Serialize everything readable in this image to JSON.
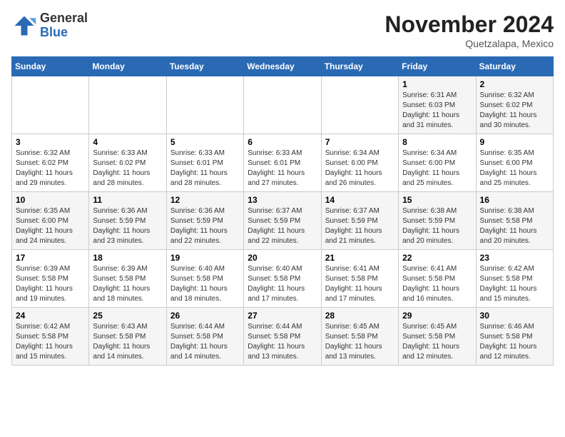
{
  "header": {
    "logo_general": "General",
    "logo_blue": "Blue",
    "month_title": "November 2024",
    "subtitle": "Quetzalapa, Mexico"
  },
  "weekdays": [
    "Sunday",
    "Monday",
    "Tuesday",
    "Wednesday",
    "Thursday",
    "Friday",
    "Saturday"
  ],
  "weeks": [
    [
      {
        "day": "",
        "info": ""
      },
      {
        "day": "",
        "info": ""
      },
      {
        "day": "",
        "info": ""
      },
      {
        "day": "",
        "info": ""
      },
      {
        "day": "",
        "info": ""
      },
      {
        "day": "1",
        "info": "Sunrise: 6:31 AM\nSunset: 6:03 PM\nDaylight: 11 hours and 31 minutes."
      },
      {
        "day": "2",
        "info": "Sunrise: 6:32 AM\nSunset: 6:02 PM\nDaylight: 11 hours and 30 minutes."
      }
    ],
    [
      {
        "day": "3",
        "info": "Sunrise: 6:32 AM\nSunset: 6:02 PM\nDaylight: 11 hours and 29 minutes."
      },
      {
        "day": "4",
        "info": "Sunrise: 6:33 AM\nSunset: 6:02 PM\nDaylight: 11 hours and 28 minutes."
      },
      {
        "day": "5",
        "info": "Sunrise: 6:33 AM\nSunset: 6:01 PM\nDaylight: 11 hours and 28 minutes."
      },
      {
        "day": "6",
        "info": "Sunrise: 6:33 AM\nSunset: 6:01 PM\nDaylight: 11 hours and 27 minutes."
      },
      {
        "day": "7",
        "info": "Sunrise: 6:34 AM\nSunset: 6:00 PM\nDaylight: 11 hours and 26 minutes."
      },
      {
        "day": "8",
        "info": "Sunrise: 6:34 AM\nSunset: 6:00 PM\nDaylight: 11 hours and 25 minutes."
      },
      {
        "day": "9",
        "info": "Sunrise: 6:35 AM\nSunset: 6:00 PM\nDaylight: 11 hours and 25 minutes."
      }
    ],
    [
      {
        "day": "10",
        "info": "Sunrise: 6:35 AM\nSunset: 6:00 PM\nDaylight: 11 hours and 24 minutes."
      },
      {
        "day": "11",
        "info": "Sunrise: 6:36 AM\nSunset: 5:59 PM\nDaylight: 11 hours and 23 minutes."
      },
      {
        "day": "12",
        "info": "Sunrise: 6:36 AM\nSunset: 5:59 PM\nDaylight: 11 hours and 22 minutes."
      },
      {
        "day": "13",
        "info": "Sunrise: 6:37 AM\nSunset: 5:59 PM\nDaylight: 11 hours and 22 minutes."
      },
      {
        "day": "14",
        "info": "Sunrise: 6:37 AM\nSunset: 5:59 PM\nDaylight: 11 hours and 21 minutes."
      },
      {
        "day": "15",
        "info": "Sunrise: 6:38 AM\nSunset: 5:59 PM\nDaylight: 11 hours and 20 minutes."
      },
      {
        "day": "16",
        "info": "Sunrise: 6:38 AM\nSunset: 5:58 PM\nDaylight: 11 hours and 20 minutes."
      }
    ],
    [
      {
        "day": "17",
        "info": "Sunrise: 6:39 AM\nSunset: 5:58 PM\nDaylight: 11 hours and 19 minutes."
      },
      {
        "day": "18",
        "info": "Sunrise: 6:39 AM\nSunset: 5:58 PM\nDaylight: 11 hours and 18 minutes."
      },
      {
        "day": "19",
        "info": "Sunrise: 6:40 AM\nSunset: 5:58 PM\nDaylight: 11 hours and 18 minutes."
      },
      {
        "day": "20",
        "info": "Sunrise: 6:40 AM\nSunset: 5:58 PM\nDaylight: 11 hours and 17 minutes."
      },
      {
        "day": "21",
        "info": "Sunrise: 6:41 AM\nSunset: 5:58 PM\nDaylight: 11 hours and 17 minutes."
      },
      {
        "day": "22",
        "info": "Sunrise: 6:41 AM\nSunset: 5:58 PM\nDaylight: 11 hours and 16 minutes."
      },
      {
        "day": "23",
        "info": "Sunrise: 6:42 AM\nSunset: 5:58 PM\nDaylight: 11 hours and 15 minutes."
      }
    ],
    [
      {
        "day": "24",
        "info": "Sunrise: 6:42 AM\nSunset: 5:58 PM\nDaylight: 11 hours and 15 minutes."
      },
      {
        "day": "25",
        "info": "Sunrise: 6:43 AM\nSunset: 5:58 PM\nDaylight: 11 hours and 14 minutes."
      },
      {
        "day": "26",
        "info": "Sunrise: 6:44 AM\nSunset: 5:58 PM\nDaylight: 11 hours and 14 minutes."
      },
      {
        "day": "27",
        "info": "Sunrise: 6:44 AM\nSunset: 5:58 PM\nDaylight: 11 hours and 13 minutes."
      },
      {
        "day": "28",
        "info": "Sunrise: 6:45 AM\nSunset: 5:58 PM\nDaylight: 11 hours and 13 minutes."
      },
      {
        "day": "29",
        "info": "Sunrise: 6:45 AM\nSunset: 5:58 PM\nDaylight: 11 hours and 12 minutes."
      },
      {
        "day": "30",
        "info": "Sunrise: 6:46 AM\nSunset: 5:58 PM\nDaylight: 11 hours and 12 minutes."
      }
    ]
  ]
}
